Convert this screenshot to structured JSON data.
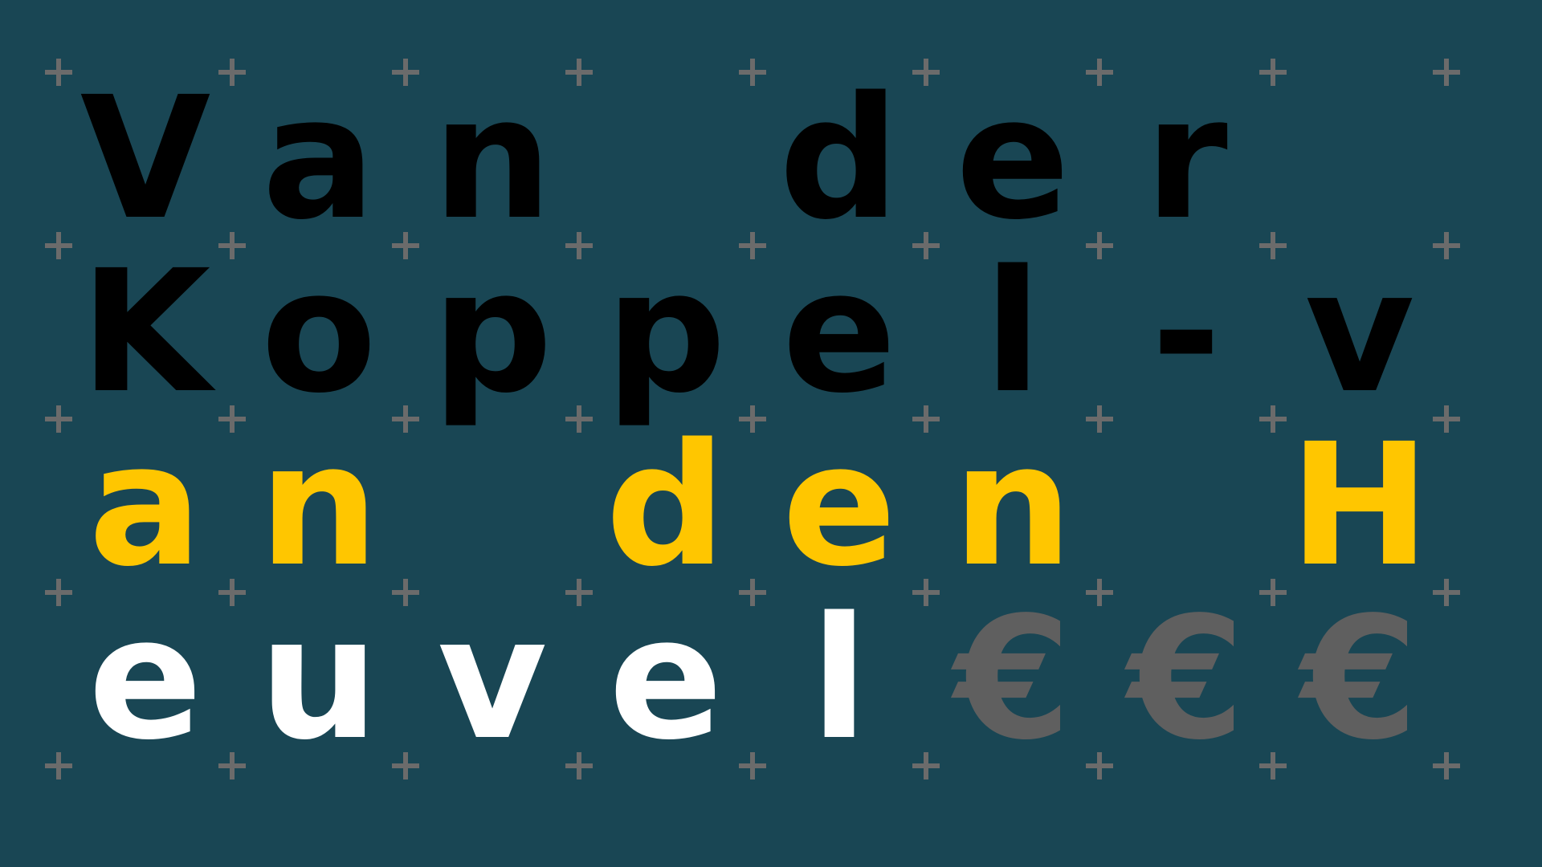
{
  "grid": {
    "rows": [
      [
        {
          "char": "V",
          "color": "#000000"
        },
        {
          "char": "a",
          "color": "#000000"
        },
        {
          "char": "n",
          "color": "#000000"
        },
        {
          "char": "",
          "color": "#000000"
        },
        {
          "char": "d",
          "color": "#000000"
        },
        {
          "char": "e",
          "color": "#000000"
        },
        {
          "char": "r",
          "color": "#000000"
        },
        {
          "char": "",
          "color": "#000000"
        }
      ],
      [
        {
          "char": "K",
          "color": "#000000"
        },
        {
          "char": "o",
          "color": "#000000"
        },
        {
          "char": "p",
          "color": "#000000"
        },
        {
          "char": "p",
          "color": "#000000"
        },
        {
          "char": "e",
          "color": "#000000"
        },
        {
          "char": "l",
          "color": "#000000"
        },
        {
          "char": "-",
          "color": "#000000"
        },
        {
          "char": "v",
          "color": "#000000"
        }
      ],
      [
        {
          "char": "a",
          "color": "#ffc600"
        },
        {
          "char": "n",
          "color": "#ffc600"
        },
        {
          "char": "",
          "color": "#ffc600"
        },
        {
          "char": "d",
          "color": "#ffc600"
        },
        {
          "char": "e",
          "color": "#ffc600"
        },
        {
          "char": "n",
          "color": "#ffc600"
        },
        {
          "char": "",
          "color": "#ffc600"
        },
        {
          "char": "H",
          "color": "#ffc600"
        }
      ],
      [
        {
          "char": "e",
          "color": "#ffffff"
        },
        {
          "char": "u",
          "color": "#ffffff"
        },
        {
          "char": "v",
          "color": "#ffffff"
        },
        {
          "char": "e",
          "color": "#ffffff"
        },
        {
          "char": "l",
          "color": "#ffffff"
        },
        {
          "char": "€",
          "color": "#5f5f5f"
        },
        {
          "char": "€",
          "color": "#5f5f5f"
        },
        {
          "char": "€",
          "color": "#5f5f5f"
        }
      ]
    ]
  },
  "colors": {
    "background": "#194654",
    "plus_marker": "#6b6b6b"
  },
  "markers": {
    "symbol": "plus-icon"
  }
}
